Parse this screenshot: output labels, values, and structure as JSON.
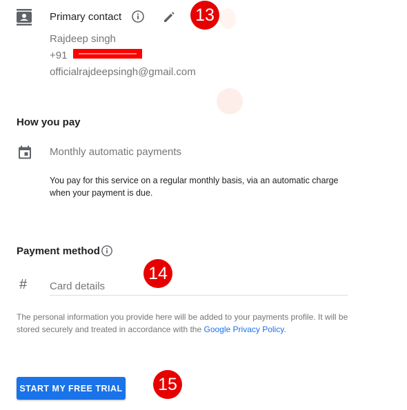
{
  "contact": {
    "label": "Primary contact",
    "name": "Rajdeep singh",
    "phone_prefix": "+91",
    "email": "officialrajdeepsingh@gmail.com"
  },
  "how_you_pay": {
    "title": "How you pay",
    "plan": "Monthly automatic payments",
    "description": "You pay for this service on a regular monthly basis, via an automatic charge when your payment is due."
  },
  "payment_method": {
    "title": "Payment method",
    "card_placeholder": "Card details",
    "privacy_text": "The personal information you provide here will be added to your payments profile. It will be stored securely and treated in accordance with the ",
    "privacy_link": "Google Privacy Policy",
    "privacy_end": "."
  },
  "actions": {
    "trial_button": "START MY FREE TRIAL"
  },
  "annotations": {
    "step_13": "13",
    "step_14": "14",
    "step_15": "15"
  },
  "colors": {
    "accent": "#1a73e8",
    "badge": "#e60000",
    "redaction": "#ff0000"
  }
}
